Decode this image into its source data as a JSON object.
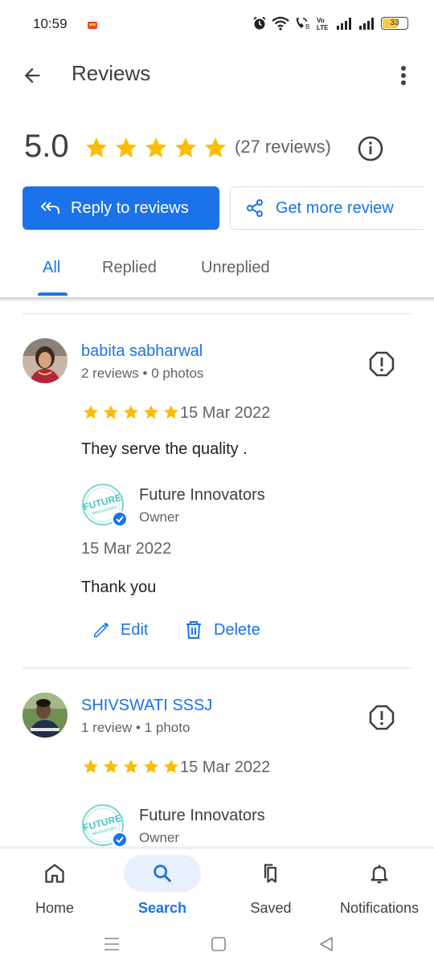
{
  "status_bar": {
    "time": "10:59",
    "battery": "33",
    "network_label": "Vo LTE"
  },
  "app_bar": {
    "title": "Reviews"
  },
  "summary": {
    "rating": "5.0",
    "stars": 5,
    "count_text": "(27 reviews)"
  },
  "actions": {
    "reply_label": "Reply to reviews",
    "more_reviews_label": "Get more review"
  },
  "tabs": [
    {
      "label": "All",
      "active": true
    },
    {
      "label": "Replied",
      "active": false
    },
    {
      "label": "Unreplied",
      "active": false
    }
  ],
  "reviews": [
    {
      "name": "babita sabharwal",
      "meta": "2 reviews • 0 photos",
      "stars": 5,
      "date": "15 Mar 2022",
      "text": "They serve the quality .",
      "owner": {
        "name": "Future Innovators",
        "role": "Owner",
        "reply_date": "15 Mar 2022",
        "reply_text": "Thank you"
      },
      "edit_label": "Edit",
      "delete_label": "Delete"
    },
    {
      "name": "SHIVSWATI SSSJ",
      "meta": "1 review • 1 photo",
      "stars": 5,
      "date": "15 Mar 2022",
      "owner": {
        "name": "Future Innovators",
        "role": "Owner"
      }
    }
  ],
  "bottom_nav": [
    {
      "label": "Home",
      "icon": "home-icon"
    },
    {
      "label": "Search",
      "icon": "search-icon",
      "active": true
    },
    {
      "label": "Saved",
      "icon": "saved-icon"
    },
    {
      "label": "Notifications",
      "icon": "bell-icon"
    }
  ],
  "colors": {
    "accent": "#1a73e8",
    "star": "#fbbc04",
    "text_secondary": "#5f6368"
  }
}
